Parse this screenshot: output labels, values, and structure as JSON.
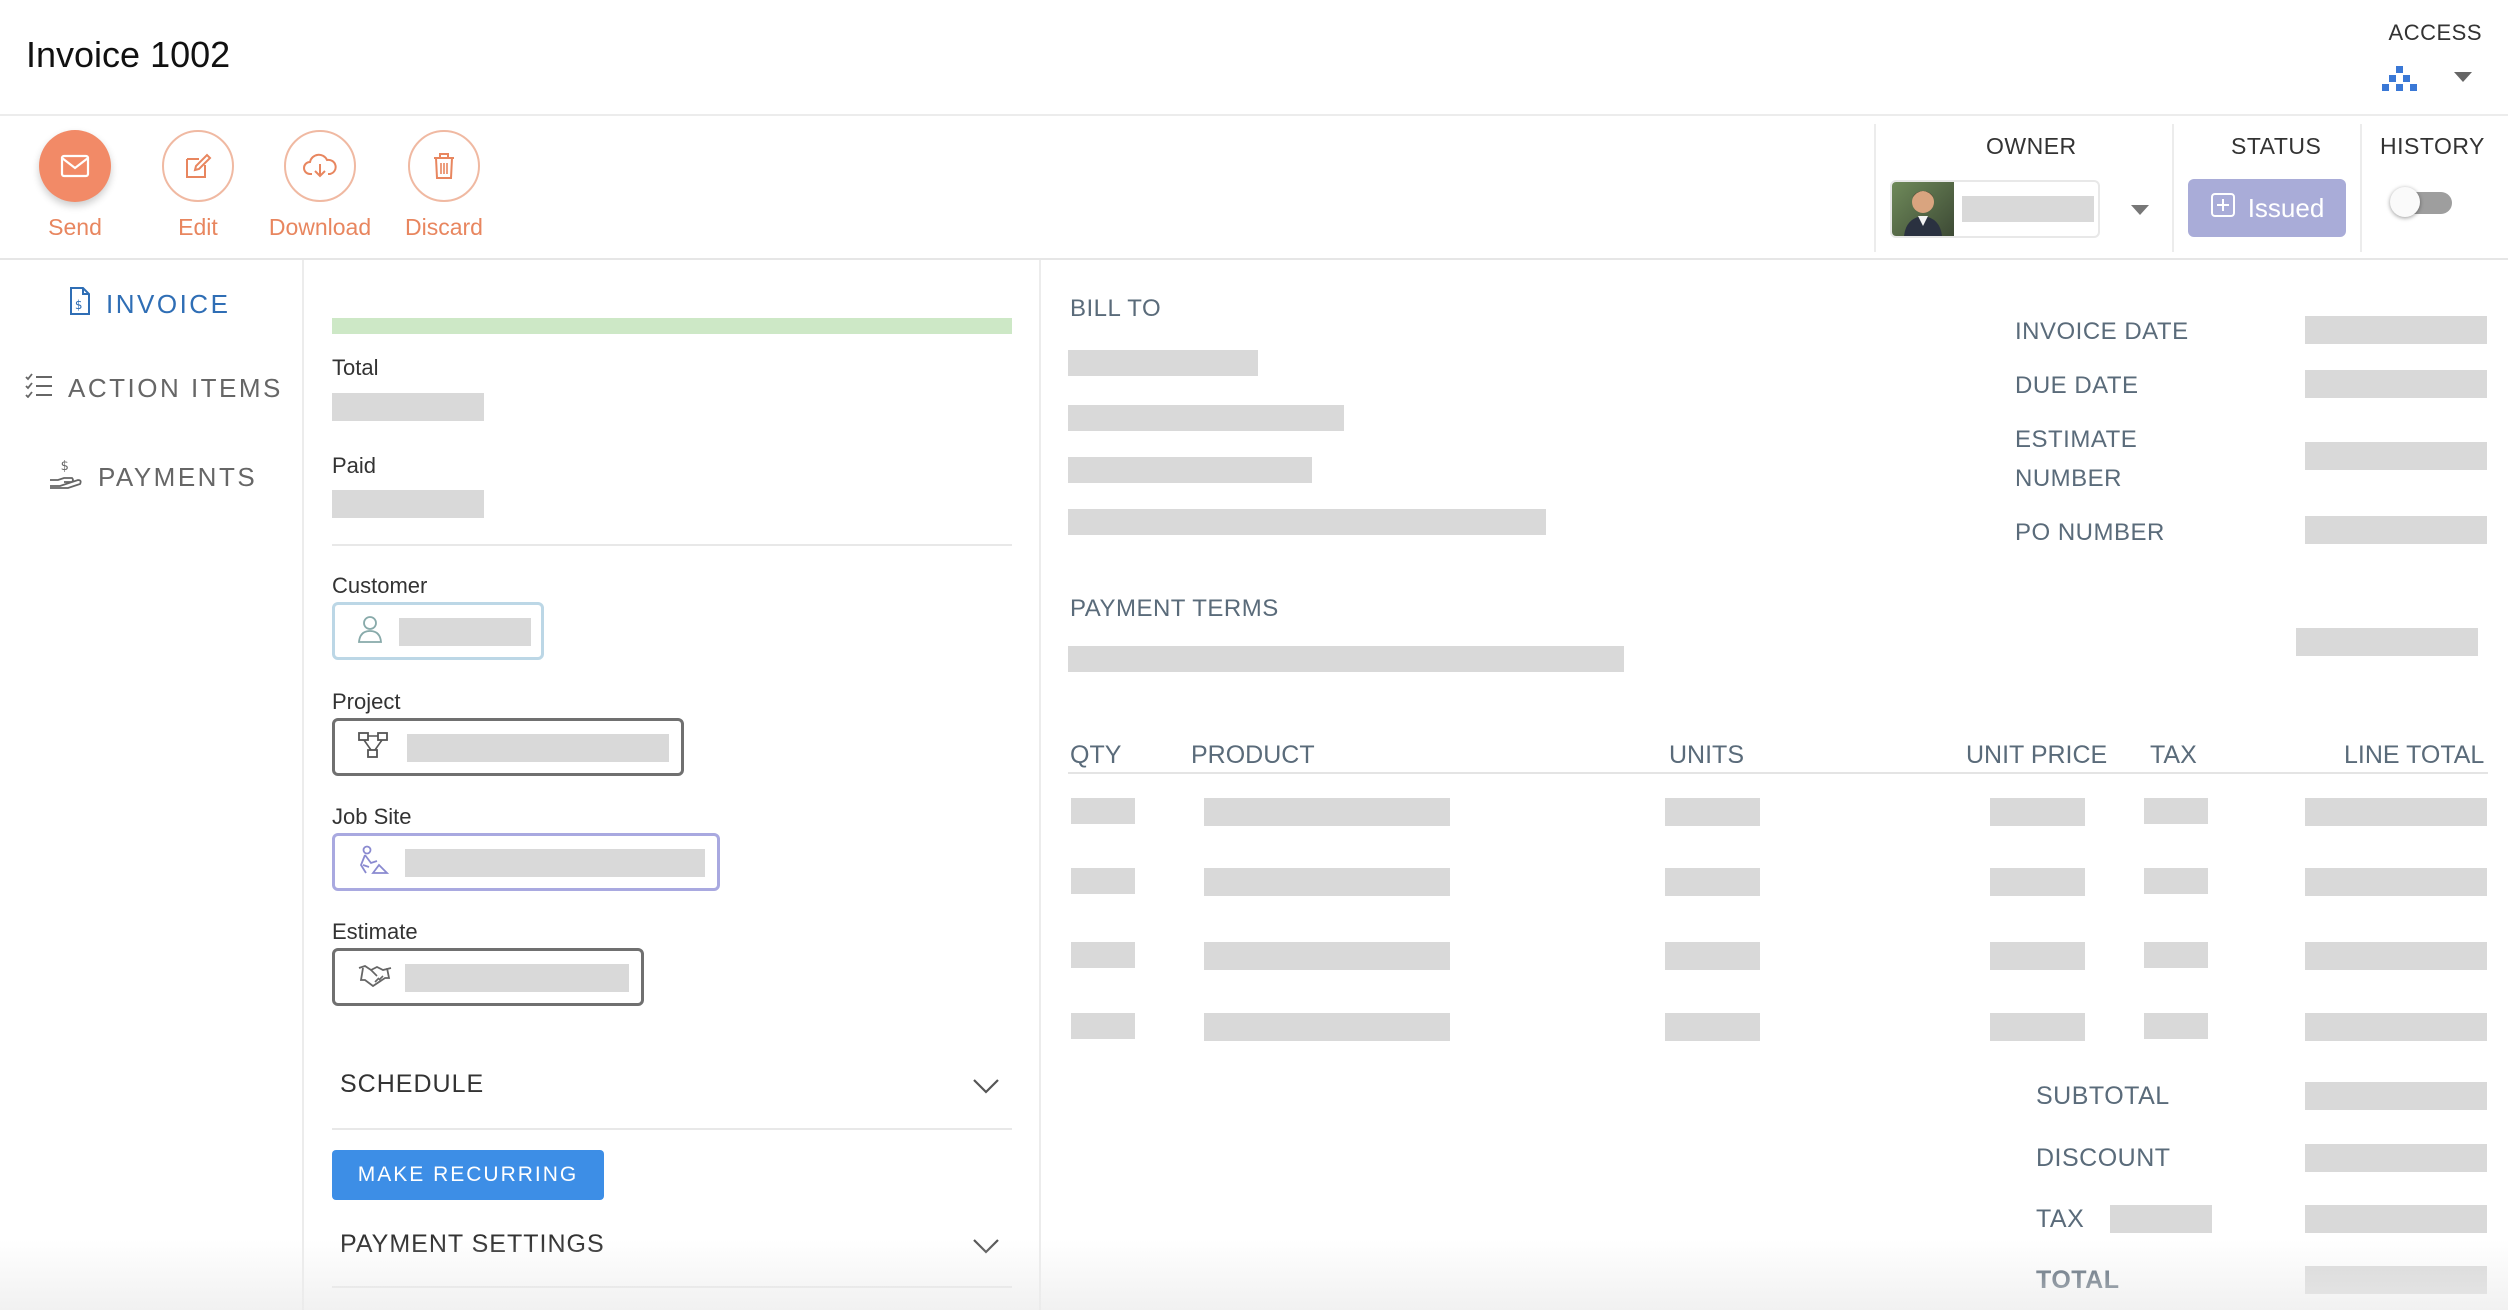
{
  "header": {
    "title": "Invoice 1002",
    "access_label": "ACCESS"
  },
  "toolbar": {
    "send": "Send",
    "edit": "Edit",
    "download": "Download",
    "discard": "Discard"
  },
  "right_header": {
    "owner_label": "OWNER",
    "status_label": "STATUS",
    "status_value": "Issued",
    "history_label": "HISTORY"
  },
  "sidebar": {
    "items": [
      {
        "label": "INVOICE",
        "icon": "invoice-icon",
        "active": true
      },
      {
        "label": "ACTION ITEMS",
        "icon": "checklist-icon"
      },
      {
        "label": "PAYMENTS",
        "icon": "payments-icon"
      }
    ]
  },
  "form": {
    "total_label": "Total",
    "paid_label": "Paid",
    "customer_label": "Customer",
    "project_label": "Project",
    "jobsite_label": "Job Site",
    "estimate_label": "Estimate",
    "schedule_label": "SCHEDULE",
    "make_recurring": "MAKE RECURRING",
    "payment_settings_label": "PAYMENT SETTINGS"
  },
  "invoice": {
    "bill_to": "BILL TO",
    "payment_terms": "PAYMENT TERMS",
    "invoice_date": "INVOICE DATE",
    "due_date": "DUE DATE",
    "estimate_number_l1": "ESTIMATE",
    "estimate_number_l2": "NUMBER",
    "po_number": "PO NUMBER",
    "columns": [
      "QTY",
      "PRODUCT",
      "UNITS",
      "UNIT PRICE",
      "TAX",
      "LINE TOTAL"
    ],
    "subtotal": "SUBTOTAL",
    "discount": "DISCOUNT",
    "tax": "TAX",
    "total": "TOTAL"
  },
  "colors": {
    "accent_orange": "#f28a67",
    "primary_blue": "#3d8ee6",
    "status_purple": "#a9acd8",
    "sidebar_active": "#2f6eb5"
  }
}
